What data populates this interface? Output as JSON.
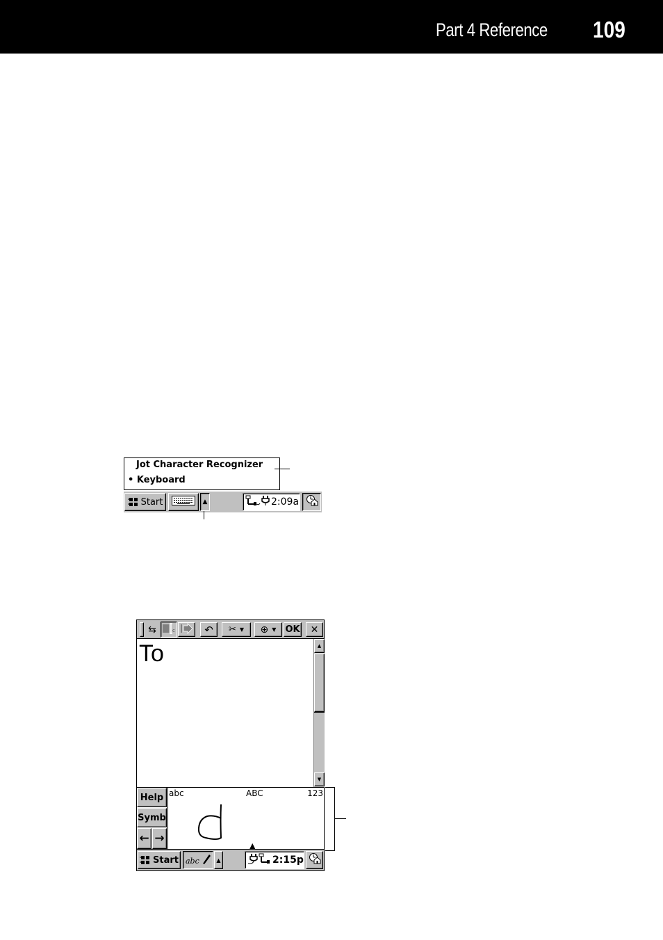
{
  "header": {
    "section": "Part 4  Reference",
    "page_number": "109"
  },
  "figure1": {
    "input_menu": {
      "items": [
        {
          "label": "Jot Character Recognizer",
          "selected": false
        },
        {
          "label": "Keyboard",
          "selected": true,
          "bullet": "•"
        }
      ]
    },
    "taskbar": {
      "start_label": "Start",
      "input_panel_icon": "keyboard-icon",
      "input_menu_arrow": "▲",
      "tray_icons": [
        "network-icon",
        "power-plug-icon"
      ],
      "clock": "2:09a",
      "desktop_icon": "show-desktop-icon"
    }
  },
  "figure2": {
    "toolbar": {
      "buttons": [
        {
          "name": "grip",
          "icon": "toolbar-grip-icon"
        },
        {
          "name": "swap",
          "icon": "swap-arrows-icon",
          "glyph": "⇆"
        },
        {
          "name": "insert-space",
          "icon": "insert-space-icon"
        },
        {
          "name": "next",
          "icon": "forward-arrow-icon",
          "glyph": "➡"
        },
        {
          "name": "undo",
          "icon": "undo-icon",
          "glyph": "↶"
        },
        {
          "name": "edit",
          "icon": "cut-paste-icon",
          "glyph": "✂"
        },
        {
          "name": "zoom",
          "icon": "zoom-icon",
          "glyph": "⊕"
        }
      ],
      "ok_label": "OK",
      "close_glyph": "✕"
    },
    "document_text": "To",
    "scrollbar": {
      "up": "▲",
      "down": "▼",
      "position_fraction": 0.0,
      "thumb_fraction": 0.4
    },
    "recognizer": {
      "help_label": "Help",
      "symb_label": "Symb",
      "left_arrow": "←",
      "right_arrow": "→",
      "zone_labels": [
        "abc",
        "ABC",
        "123"
      ],
      "ink_character": "d",
      "marker": "▲"
    },
    "taskbar": {
      "start_label": "Start",
      "input_panel_icon": "handwriting-pen-icon",
      "input_menu_arrow": "▲",
      "tray_icons": [
        "power-plug-icon",
        "network-icon"
      ],
      "clock": "2:15p",
      "desktop_icon": "show-desktop-icon"
    }
  }
}
